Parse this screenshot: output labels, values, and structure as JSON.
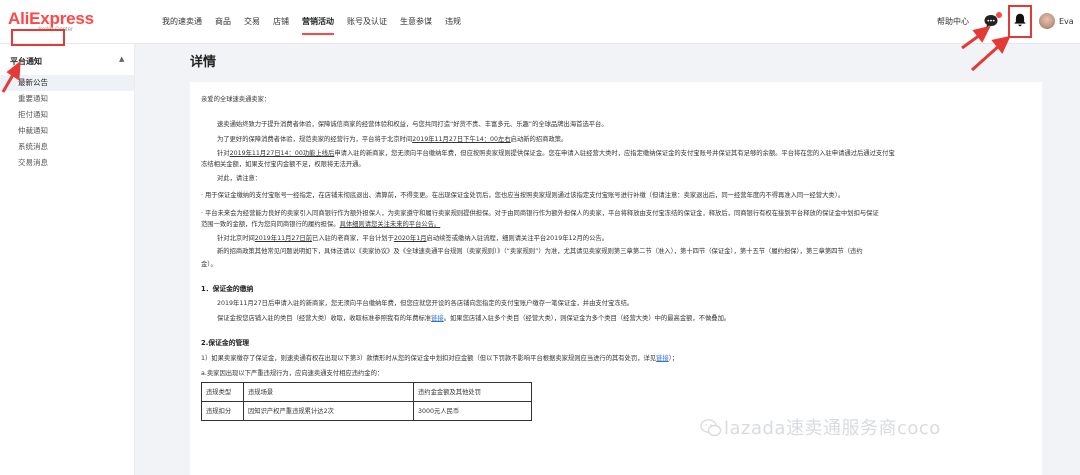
{
  "header": {
    "logo_main": "AliExpress",
    "logo_sub": "Seller Center",
    "nav": [
      "我的速卖通",
      "商品",
      "交易",
      "店铺",
      "营销活动",
      "账号及认证",
      "生意参谋",
      "违规"
    ],
    "help": "帮助中心",
    "user_name": "Eva"
  },
  "sidebar": {
    "heading": "平台通知",
    "items": [
      "最新公告",
      "重要通知",
      "拒付通知",
      "仲裁通知",
      "系统消息",
      "交易消息"
    ]
  },
  "page_title": "详情",
  "article": {
    "greeting": "亲爱的全球速卖通卖家：",
    "p1": "速卖通始终致力于提升消费者体验，保障诚信商家的经营体验和权益，与您共同打造“好货不贵、丰富多元、乐趣”的全球品牌出海首选平台。",
    "p2_a": "为了更好的保障消费者体验，规范卖家的经营行为，平台将于北京时间",
    "p2_u": "2019年11月27日下午14：00左右",
    "p2_b": "启动新的招商政策。",
    "p3_a": "针对",
    "p3_u": "2019年11月27日14：00功能上线后",
    "p3_b": "申请入驻的新商家，您无须向平台缴纳年费，但应按照卖家规则提供保证金。您在申请入驻经营大类时，应指定缴纳保证金的支付宝账号并保证其有足够的余额。平台将在您的入驻申请通过后通过支付宝",
    "p3_c": "冻结相关金额，如果支付宝内金额不足，权限将无法开通。",
    "p4": "对此，请注意：",
    "p5": "· 用于保证金缴纳的支付宝账号一经指定，在店铺未彻底退出、清算前，不得变更。在出现保证金处罚后，您也应当按照卖家规则通过该指定支付宝账号进行补缴（但请注意：卖家退出后，同一经营年度内不得再准入同一经营大类）。",
    "p6_a": "· 平台未来会为经营能力良好的卖家引入同商银行作为额外担保人，为卖家遵守和履行卖家规则提供担保。对于由同商银行作为额外担保人的卖家，平台将释放由支付宝冻结的保证金，释放后，同商银行有权在接到平台释放的保证金中划扣与保证",
    "p6_b": "范围一致的金额，作为您向同商银行的履约担保。",
    "p6_u": "具体细则请您关注未来的平台公告。",
    "p7_a": "针对北京时间",
    "p7_u1": "2019年11月27日前",
    "p7_b": "已入驻的老商家，平台计划于",
    "p7_u2": "2020年1月",
    "p7_c": "启动续签或缴纳入驻流程，细则请关注平台2019年12月的公告。",
    "p8_a": "新的招商政策其他常见问题说明如下，具体还请以《卖家协议》及《全球速卖通平台规则（卖家规则）》（“卖家规则”）为准，尤其请见卖家规则第三章第二节（准入），第十四节（保证金），第十五节（履约担保），第三章第四节（违约",
    "p8_b": "金）。",
    "s1_title": "1．保证金的缴纳",
    "s1_p1": "2019年11月27日后申请入驻的新商家，您无须向平台缴纳年费，但您应就您开设的各店铺向您指定的支付宝账户缴存一笔保证金，并由支付宝冻结。",
    "s1_p2_a": "保证金按您店铺入驻的类目（经营大类）收取，收取标准参照我有的年费标准",
    "s1_p2_link": "链接",
    "s1_p2_b": "。如果您店铺入驻多个类目（经营大类），则保证金为多个类目（经营大类）中的最高金额，不做叠加。",
    "s2_title": "2.保证金的管理",
    "s2_p1_a": "1）如果卖家缴存了保证金，则速卖通有权在出现以下第3）款情形时从您的保证金中划扣对应金额（但以下罚款不影响平台根据卖家规则应当进行的其有处罚，详见",
    "s2_p1_link": "链接",
    "s2_p1_b": "）；",
    "s2_p2": "a.卖家因出现以下严重违规行为，应向速卖通支付相应违约金的：",
    "table": {
      "headers": [
        "违规类型",
        "违规场景",
        "违约金金额及其他处罚"
      ],
      "rows": [
        [
          "违规扣分",
          "因知识产权严重违规累计达2次",
          "3000元人民币"
        ]
      ]
    }
  },
  "watermark": "lazada速卖通服务商coco",
  "colors": {
    "brand": "#ff4747",
    "annotation_red": "#e53935",
    "link": "#2f6fd6"
  },
  "icons": [
    "message-icon",
    "bell-icon",
    "avatar",
    "chevron-up-icon",
    "wechat-icon"
  ]
}
